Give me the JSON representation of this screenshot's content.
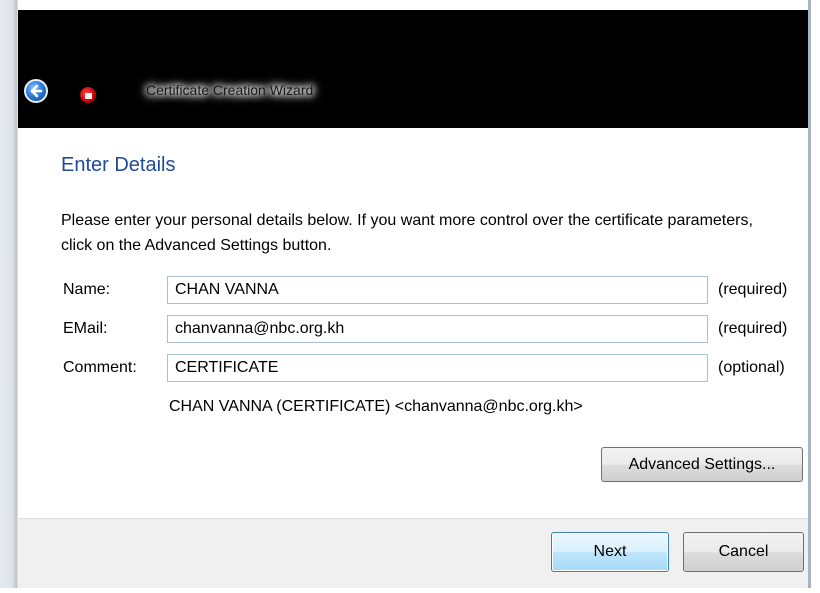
{
  "window": {
    "title": "Certificate Creation Wizard"
  },
  "page": {
    "heading": "Enter Details",
    "intro": "Please enter your personal details below. If you want more control over the certificate parameters, click on the Advanced Settings button."
  },
  "form": {
    "name": {
      "label": "Name:",
      "value": "CHAN VANNA",
      "hint": "(required)"
    },
    "email": {
      "label": "EMail:",
      "value": "chanvanna@nbc.org.kh",
      "hint": "(required)"
    },
    "comment": {
      "label": "Comment:",
      "value": "CERTIFICATE",
      "hint": "(optional)"
    },
    "summary": "CHAN VANNA (CERTIFICATE) <chanvanna@nbc.org.kh>"
  },
  "buttons": {
    "advanced": "Advanced Settings...",
    "next": "Next",
    "cancel": "Cancel"
  },
  "icons": {
    "back": "back-arrow-icon",
    "app": "certificate-app-icon"
  },
  "colors": {
    "heading": "#1f4b99",
    "titlebar": "#000000",
    "footer": "#f0f0f0",
    "field_border": "#a7c0d8"
  }
}
